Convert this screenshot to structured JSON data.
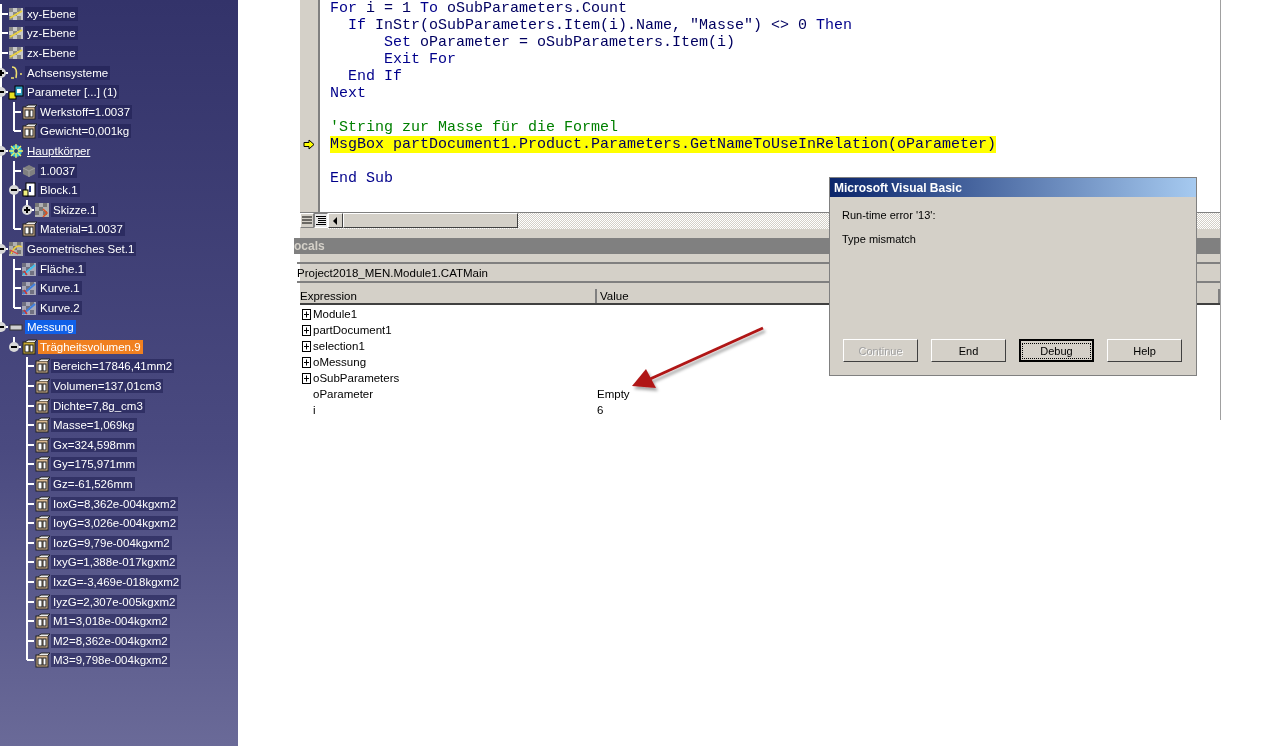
{
  "tree": [
    {
      "label": "xy-Ebene",
      "kind": "plane",
      "selected": false,
      "highlighted": false
    },
    {
      "label": "yz-Ebene",
      "kind": "plane",
      "selected": false,
      "highlighted": false
    },
    {
      "label": "zx-Ebene",
      "kind": "plane",
      "selected": false,
      "highlighted": false
    },
    {
      "label": "Achsensysteme",
      "kind": "axis",
      "expanded": false,
      "selected": false,
      "highlighted": false
    },
    {
      "label": "Parameter [...] (1)",
      "kind": "parameters",
      "expanded": true,
      "selected": false,
      "highlighted": false,
      "children": [
        {
          "label": "Werkstoff=1.0037",
          "kind": "param",
          "selected": false,
          "highlighted": false
        },
        {
          "label": "Gewicht=0,001kg",
          "kind": "param",
          "selected": false,
          "highlighted": false
        }
      ]
    },
    {
      "label": "Hauptkörper",
      "kind": "body",
      "expanded": true,
      "selected": false,
      "highlighted": false,
      "children": [
        {
          "label": "1.0037",
          "kind": "solid",
          "selected": false,
          "highlighted": false
        },
        {
          "label": "Block.1",
          "kind": "pad",
          "expanded": true,
          "selected": false,
          "highlighted": false,
          "children": [
            {
              "label": "Skizze.1",
              "kind": "sketch",
              "expanded": false,
              "selected": false,
              "highlighted": false
            }
          ]
        },
        {
          "label": "Material=1.0037",
          "kind": "param",
          "selected": false,
          "highlighted": false
        }
      ]
    },
    {
      "label": "Geometrisches Set.1",
      "kind": "geoset",
      "expanded": true,
      "selected": false,
      "highlighted": false,
      "children": [
        {
          "label": "Fläche.1",
          "kind": "surface",
          "selected": false,
          "highlighted": false
        },
        {
          "label": "Kurve.1",
          "kind": "curve",
          "selected": false,
          "highlighted": false
        },
        {
          "label": "Kurve.2",
          "kind": "curve",
          "selected": false,
          "highlighted": false
        }
      ]
    },
    {
      "label": "Messung",
      "kind": "measure",
      "expanded": true,
      "selected": true,
      "highlighted": false,
      "children": [
        {
          "label": "Trägheitsvolumen.9",
          "kind": "inertia",
          "expanded": true,
          "selected": false,
          "highlighted": true,
          "children": [
            {
              "label": "Bereich=17846,41mm2",
              "kind": "value",
              "selected": false,
              "highlighted": false
            },
            {
              "label": "Volumen=137,01cm3",
              "kind": "value",
              "selected": false,
              "highlighted": false
            },
            {
              "label": "Dichte=7,8g_cm3",
              "kind": "value",
              "selected": false,
              "highlighted": false
            },
            {
              "label": "Masse=1,069kg",
              "kind": "value",
              "selected": false,
              "highlighted": false
            },
            {
              "label": "Gx=324,598mm",
              "kind": "value",
              "selected": false,
              "highlighted": false
            },
            {
              "label": "Gy=175,971mm",
              "kind": "value",
              "selected": false,
              "highlighted": false
            },
            {
              "label": "Gz=-61,526mm",
              "kind": "value",
              "selected": false,
              "highlighted": false
            },
            {
              "label": "IoxG=8,362e-004kgxm2",
              "kind": "value",
              "selected": false,
              "highlighted": false
            },
            {
              "label": "IoyG=3,026e-004kgxm2",
              "kind": "value",
              "selected": false,
              "highlighted": false
            },
            {
              "label": "IozG=9,79e-004kgxm2",
              "kind": "value",
              "selected": false,
              "highlighted": false
            },
            {
              "label": "IxyG=1,388e-017kgxm2",
              "kind": "value",
              "selected": false,
              "highlighted": false
            },
            {
              "label": "IxzG=-3,469e-018kgxm2",
              "kind": "value",
              "selected": false,
              "highlighted": false
            },
            {
              "label": "IyzG=2,307e-005kgxm2",
              "kind": "value",
              "selected": false,
              "highlighted": false
            },
            {
              "label": "M1=3,018e-004kgxm2",
              "kind": "value",
              "selected": false,
              "highlighted": false
            },
            {
              "label": "M2=8,362e-004kgxm2",
              "kind": "value",
              "selected": false,
              "highlighted": false
            },
            {
              "label": "M3=9,798e-004kgxm2",
              "kind": "value",
              "selected": false,
              "highlighted": false
            }
          ]
        }
      ]
    }
  ],
  "code": [
    {
      "kind": "code",
      "current": false,
      "tokens": [
        {
          "t": "For",
          "kind": "keyword"
        },
        {
          "t": " i = 1 ",
          "kind": "plain"
        },
        {
          "t": "To",
          "kind": "keyword"
        },
        {
          "t": " oSubParameters.Count",
          "kind": "plain"
        }
      ]
    },
    {
      "kind": "code",
      "current": false,
      "tokens": [
        {
          "t": "  If",
          "kind": "keyword"
        },
        {
          "t": " InStr(oSubParameters.Item(i).Name, \"Masse\") <> 0 ",
          "kind": "plain"
        },
        {
          "t": "Then",
          "kind": "keyword"
        }
      ]
    },
    {
      "kind": "code",
      "current": false,
      "tokens": [
        {
          "t": "      Set",
          "kind": "keyword"
        },
        {
          "t": " oParameter = oSubParameters.Item(i)",
          "kind": "plain"
        }
      ]
    },
    {
      "kind": "code",
      "current": false,
      "tokens": [
        {
          "t": "      Exit For",
          "kind": "keyword"
        }
      ]
    },
    {
      "kind": "code",
      "current": false,
      "tokens": [
        {
          "t": "  End If",
          "kind": "keyword"
        }
      ]
    },
    {
      "kind": "code",
      "current": false,
      "tokens": [
        {
          "t": "Next",
          "kind": "keyword"
        }
      ]
    },
    {
      "kind": "blank"
    },
    {
      "kind": "code",
      "current": false,
      "tokens": [
        {
          "t": "'String zur Masse für die Formel",
          "kind": "comment"
        }
      ]
    },
    {
      "kind": "code",
      "current": true,
      "tokens": [
        {
          "t": "MsgBox partDocument1.Product.Parameters.GetNameToUseInRelation(oParameter)",
          "kind": "plain"
        }
      ]
    },
    {
      "kind": "blank"
    },
    {
      "kind": "code",
      "current": false,
      "tokens": [
        {
          "t": "End Sub",
          "kind": "keyword"
        }
      ]
    }
  ],
  "locals": {
    "title": "ocals",
    "context": "Project2018_MEN.Module1.CATMain",
    "columns": [
      "Expression",
      "Value"
    ],
    "rows": [
      {
        "expression": "Module1",
        "expanded": false
      },
      {
        "expression": "partDocument1",
        "expanded": false
      },
      {
        "expression": "selection1",
        "expanded": false
      },
      {
        "expression": "oMessung",
        "expanded": false
      },
      {
        "expression": "oSubParameters",
        "expanded": false
      },
      {
        "expression": "oParameter",
        "value": "Empty"
      },
      {
        "expression": "i",
        "value": "6"
      }
    ]
  },
  "dialog": {
    "title": "Microsoft Visual Basic",
    "lines": [
      "Run-time error '13':",
      "Type mismatch"
    ],
    "buttons": [
      {
        "label": "Continue",
        "disabled": true,
        "focused": false
      },
      {
        "label": "End",
        "disabled": false,
        "focused": false
      },
      {
        "label": "Debug",
        "disabled": false,
        "focused": true
      },
      {
        "label": "Help",
        "disabled": false,
        "focused": false
      }
    ]
  }
}
